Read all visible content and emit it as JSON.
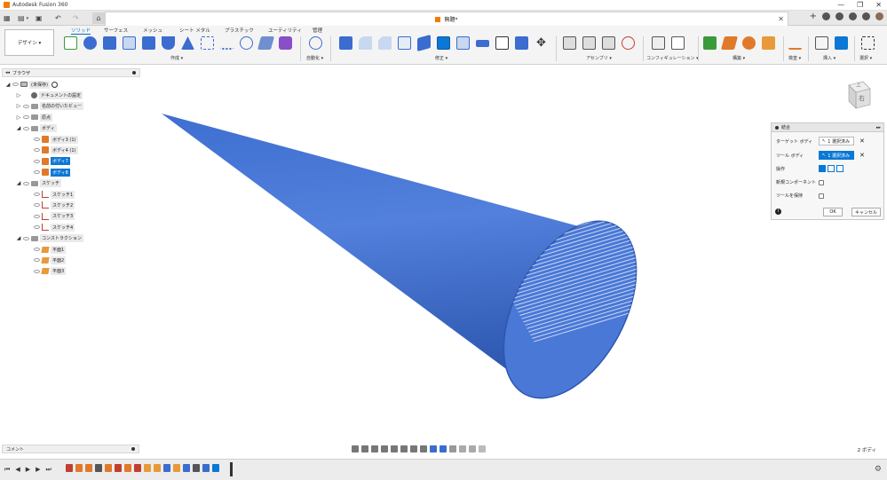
{
  "window": {
    "title": "Autodesk Fusion 360",
    "minimize": "—",
    "maximize": "❐",
    "close": "✕"
  },
  "document": {
    "tab_title": "無題*",
    "tab_close": "✕"
  },
  "quick_access": {
    "grid_icon": "▦",
    "file_icon": "▤",
    "save_icon": "▣",
    "undo_icon": "↶",
    "redo_icon": "↷",
    "home_icon": "⌂"
  },
  "toolbar": {
    "workspace_label": "デザイン ▾",
    "tabs": [
      "ソリッド",
      "サーフェス",
      "メッシュ",
      "シート メタル",
      "プラスチック",
      "ユーティリティ",
      "管理"
    ],
    "groups": [
      "作成 ▾",
      "自動化 ▾",
      "修正 ▾",
      "アセンブリ ▾",
      "コンフィギュレーション ▾",
      "構築 ▾",
      "検査 ▾",
      "挿入 ▾",
      "選択 ▾"
    ],
    "colors": {
      "accent": "#0a78d4",
      "body": "#3b6ccf",
      "orange": "#e07a2a"
    }
  },
  "browser": {
    "title": "ブラウザ",
    "nodes": [
      {
        "label": "(未保存)",
        "level": 0,
        "icon": "component",
        "expand": "◢",
        "selected": false
      },
      {
        "label": "ドキュメントの設定",
        "level": 1,
        "icon": "gear",
        "expand": "▷",
        "selected": false
      },
      {
        "label": "名前の付いたビュー",
        "level": 1,
        "icon": "folder",
        "expand": "▷",
        "selected": false
      },
      {
        "label": "原点",
        "level": 1,
        "icon": "folder",
        "expand": "▷",
        "selected": false
      },
      {
        "label": "ボディ",
        "level": 1,
        "icon": "folder",
        "expand": "◢",
        "selected": false
      },
      {
        "label": "ボディ3 (1)",
        "level": 2,
        "icon": "body",
        "expand": "",
        "selected": false
      },
      {
        "label": "ボディ4 (1)",
        "level": 2,
        "icon": "body",
        "expand": "",
        "selected": false
      },
      {
        "label": "ボディ7",
        "level": 2,
        "icon": "body",
        "expand": "",
        "selected": true
      },
      {
        "label": "ボディ8",
        "level": 2,
        "icon": "body",
        "expand": "",
        "selected": true
      },
      {
        "label": "スケッチ",
        "level": 1,
        "icon": "folder",
        "expand": "◢",
        "selected": false
      },
      {
        "label": "スケッチ1",
        "level": 2,
        "icon": "sketch",
        "expand": "",
        "selected": false
      },
      {
        "label": "スケッチ2",
        "level": 2,
        "icon": "sketch",
        "expand": "",
        "selected": false
      },
      {
        "label": "スケッチ3",
        "level": 2,
        "icon": "sketch",
        "expand": "",
        "selected": false
      },
      {
        "label": "スケッチ4",
        "level": 2,
        "icon": "sketch",
        "expand": "",
        "selected": false
      },
      {
        "label": "コンストラクション",
        "level": 1,
        "icon": "folder",
        "expand": "◢",
        "selected": false
      },
      {
        "label": "平面1",
        "level": 2,
        "icon": "plane",
        "expand": "",
        "selected": false
      },
      {
        "label": "平面2",
        "level": 2,
        "icon": "plane",
        "expand": "",
        "selected": false
      },
      {
        "label": "平面3",
        "level": 2,
        "icon": "plane",
        "expand": "",
        "selected": false
      }
    ]
  },
  "viewcube": {
    "face_top": "上",
    "face_right": "右"
  },
  "dialog": {
    "title": "結合",
    "target_label": "ターゲット ボディ",
    "target_value": "1 選択済み",
    "tool_label": "ツール ボディ",
    "tool_value": "1 選択済み",
    "operation_label": "操作",
    "new_component_label": "新規コンポーネント",
    "keep_tools_label": "ツールを保持",
    "info_icon": "i",
    "ok": "OK",
    "cancel": "キャンセル",
    "clear": "✕"
  },
  "comments": {
    "title": "コメント"
  },
  "status": {
    "body_count": "2 ボディ"
  },
  "timeline": {
    "controls": [
      "⏮",
      "◀",
      "▶",
      "▶",
      "⏭"
    ],
    "settings_icon": "⚙"
  }
}
